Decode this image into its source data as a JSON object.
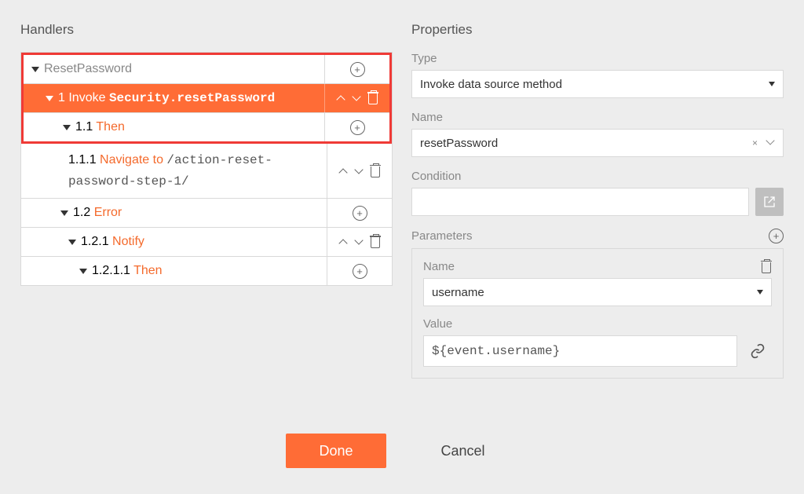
{
  "left": {
    "title": "Handlers",
    "rows": [
      {
        "id": "root",
        "level": 0,
        "caret": true,
        "parts": [
          {
            "t": "ResetPassword",
            "cls": "muted"
          }
        ],
        "controls": "plus"
      },
      {
        "id": "r1",
        "level": 1,
        "caret": true,
        "selected": true,
        "parts": [
          {
            "t": "1 ",
            "cls": ""
          },
          {
            "t": "Invoke ",
            "cls": ""
          },
          {
            "t": "Security.resetPassword",
            "cls": "mono"
          }
        ],
        "controls": "updown-trash"
      },
      {
        "id": "r11",
        "level": 2,
        "caret": true,
        "parts": [
          {
            "t": "1.1 ",
            "cls": ""
          },
          {
            "t": "Then",
            "cls": "orange-txt"
          }
        ],
        "controls": "plus"
      },
      {
        "id": "r111",
        "level": 3,
        "caret": false,
        "parts": [
          {
            "t": "1.1.1 ",
            "cls": ""
          },
          {
            "t": "Navigate to ",
            "cls": "orange-txt"
          },
          {
            "t": "/action-reset-password-step-1/",
            "cls": "mono"
          }
        ],
        "controls": "updown-trash"
      },
      {
        "id": "r12",
        "level": 2,
        "caret": true,
        "parts": [
          {
            "t": "1.2 ",
            "cls": ""
          },
          {
            "t": "Error",
            "cls": "orange-txt"
          }
        ],
        "controls": "plus"
      },
      {
        "id": "r121",
        "level": 3,
        "caret": true,
        "parts": [
          {
            "t": "1.2.1 ",
            "cls": ""
          },
          {
            "t": "Notify",
            "cls": "orange-txt"
          }
        ],
        "controls": "updown-trash"
      },
      {
        "id": "r1211",
        "level": 4,
        "caret": true,
        "parts": [
          {
            "t": "1.2.1.1 ",
            "cls": ""
          },
          {
            "t": "Then",
            "cls": "orange-txt"
          }
        ],
        "controls": "plus"
      }
    ]
  },
  "right": {
    "title": "Properties",
    "type_label": "Type",
    "type_value": "Invoke data source method",
    "name_label": "Name",
    "name_value": "resetPassword",
    "condition_label": "Condition",
    "condition_value": "",
    "parameters_label": "Parameters",
    "param_name_label": "Name",
    "param_name_value": "username",
    "param_value_label": "Value",
    "param_value_value": "${event.username}"
  },
  "footer": {
    "done": "Done",
    "cancel": "Cancel"
  }
}
